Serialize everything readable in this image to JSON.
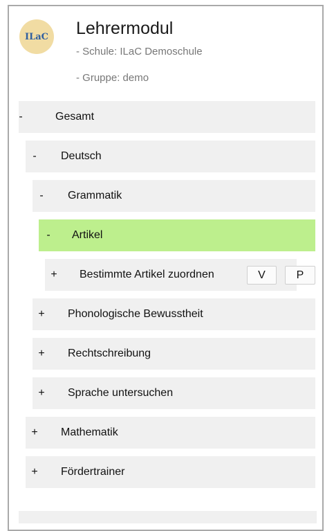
{
  "header": {
    "logo_text": "ILaC",
    "title": "Lehrermodul",
    "school": "- Schule: ILaC Demoschule",
    "group": "- Gruppe: demo"
  },
  "tree": {
    "gesamt": {
      "sign": "-",
      "label": "Gesamt"
    },
    "deutsch": {
      "sign": "-",
      "label": "Deutsch"
    },
    "grammatik": {
      "sign": "-",
      "label": "Grammatik"
    },
    "artikel": {
      "sign": "-",
      "label": "Artikel"
    },
    "bestimmte": {
      "sign": "+",
      "label": "Bestimmte Artikel zuordnen",
      "v_label": "V",
      "p_label": "P"
    },
    "phonologische": {
      "sign": "+",
      "label": "Phonologische Bewusstheit"
    },
    "rechtschreibung": {
      "sign": "+",
      "label": "Rechtschreibung"
    },
    "sprache": {
      "sign": "+",
      "label": "Sprache untersuchen"
    },
    "mathematik": {
      "sign": "+",
      "label": "Mathematik"
    },
    "foerdertrainer": {
      "sign": "+",
      "label": "Fördertrainer"
    }
  },
  "colors": {
    "active": "#bdef8d",
    "row": "#f0f0f0",
    "logo_bg": "#f1dca3"
  }
}
